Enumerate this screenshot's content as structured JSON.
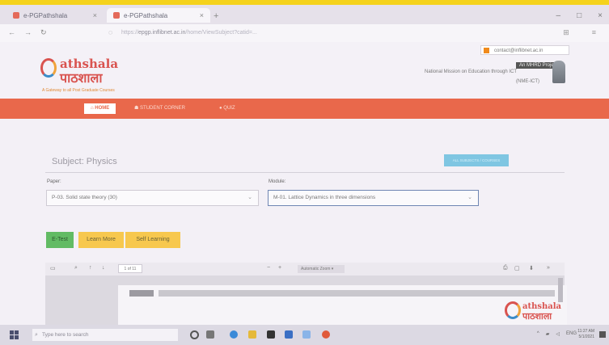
{
  "browser": {
    "tabs": [
      {
        "label": "e-PGPathshala"
      },
      {
        "label": "e-PGPathshala"
      }
    ],
    "url_host": "epgp.inflibnet.ac.in",
    "url_rest": "/home/ViewSubject?catid=..."
  },
  "site": {
    "logo_en": "athshala",
    "logo_hi": "पाठशाला",
    "tagline": "A Gateway to all Post Graduate Courses",
    "login_email": "contact@inflibnet.ac.in",
    "mhrd_badge": "An MHRD Project",
    "mission": "National Mission on Education through ICT",
    "mission_short": "(NME-ICT)"
  },
  "nav": {
    "home": "HOME",
    "student_corner": "STUDENT CORNER",
    "quiz": "QUIZ"
  },
  "content": {
    "subject": "Subject: Physics",
    "all_btn": "ALL SUBJECTS / COURSES",
    "paper_label": "Paper:",
    "paper_value": "P-03. Solid state theory (30)",
    "module_label": "Module:",
    "module_value": "M-01. Lattice Dynamics in three dimensions",
    "etest": "E-Test",
    "learn_more": "Learn More",
    "self_learning": "Self Learning"
  },
  "pdf": {
    "page_of": "1 of 11",
    "zoom": "Automatic Zoom",
    "page_number": "1",
    "logo_en": "athshala",
    "logo_hi": "पाठशाला"
  },
  "taskbar": {
    "search_placeholder": "Type here to search",
    "lang": "ENG",
    "time": "11:27 AM",
    "date": "5/1/2021"
  }
}
